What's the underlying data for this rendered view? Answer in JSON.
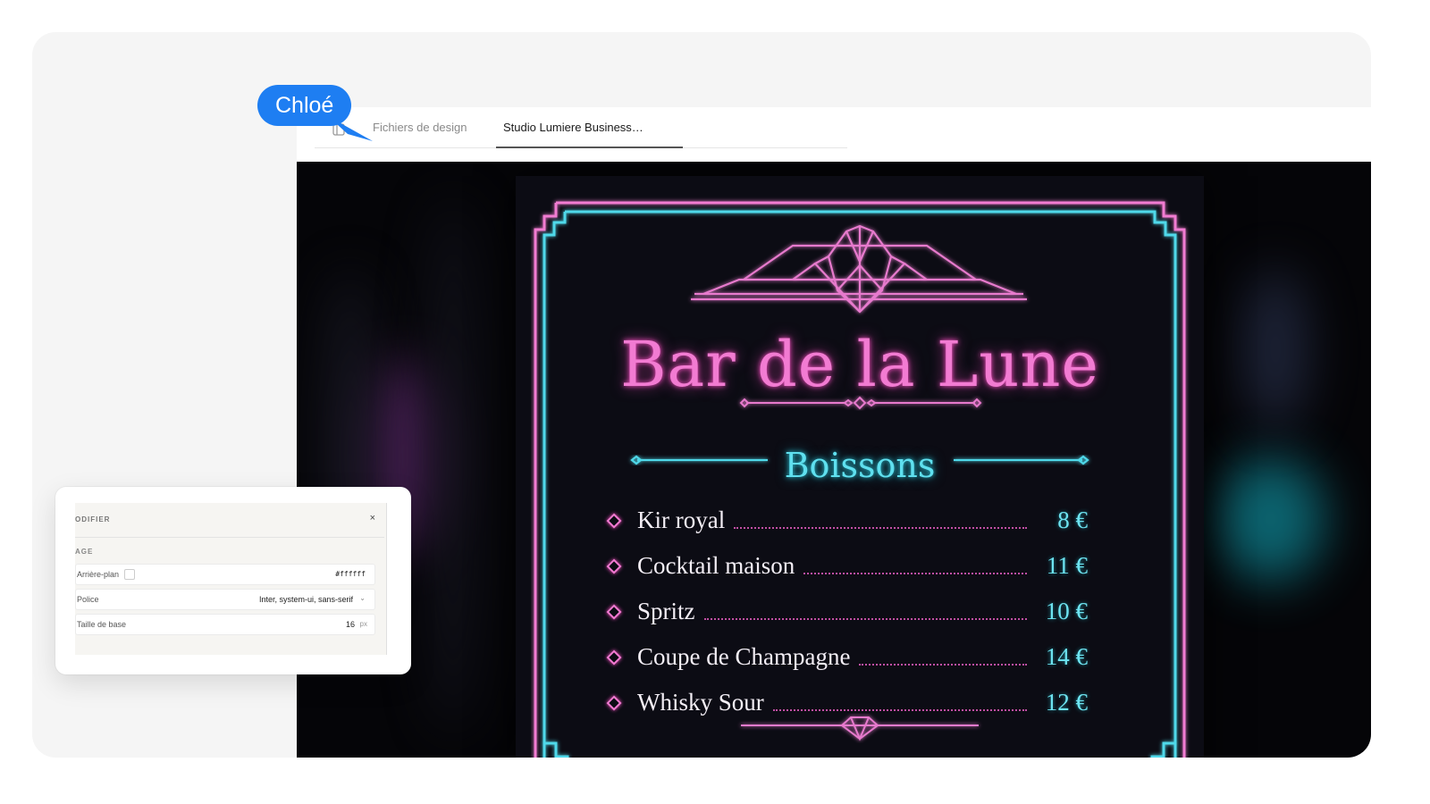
{
  "cursor": {
    "user_name": "Chloé",
    "color": "#1e7ef2"
  },
  "tabs": [
    {
      "label": "Fichiers de design",
      "active": false
    },
    {
      "label": "Studio Lumiere Business…",
      "active": true
    }
  ],
  "menu": {
    "title": "Bar de la Lune",
    "section": "Boissons",
    "items": [
      {
        "name": "Kir royal",
        "price": "8 €"
      },
      {
        "name": "Cocktail maison",
        "price": "11 €"
      },
      {
        "name": "Spritz",
        "price": "10 €"
      },
      {
        "name": "Coupe de Champagne",
        "price": "14 €"
      },
      {
        "name": "Whisky Sour",
        "price": "12 €"
      }
    ],
    "colors": {
      "pink": "#f27bd2",
      "cyan": "#5fe0ef",
      "board": "#0c0c14"
    }
  },
  "properties": {
    "header": "ODIFIER",
    "close": "×",
    "section": "AGE",
    "rows": [
      {
        "label": "Arrière-plan",
        "value": "#ffffff"
      },
      {
        "label": "Police",
        "value": "Inter, system-ui, sans-serif",
        "chevron": "⌄"
      },
      {
        "label": "Taille de base",
        "value": "16",
        "unit": "px"
      }
    ]
  }
}
